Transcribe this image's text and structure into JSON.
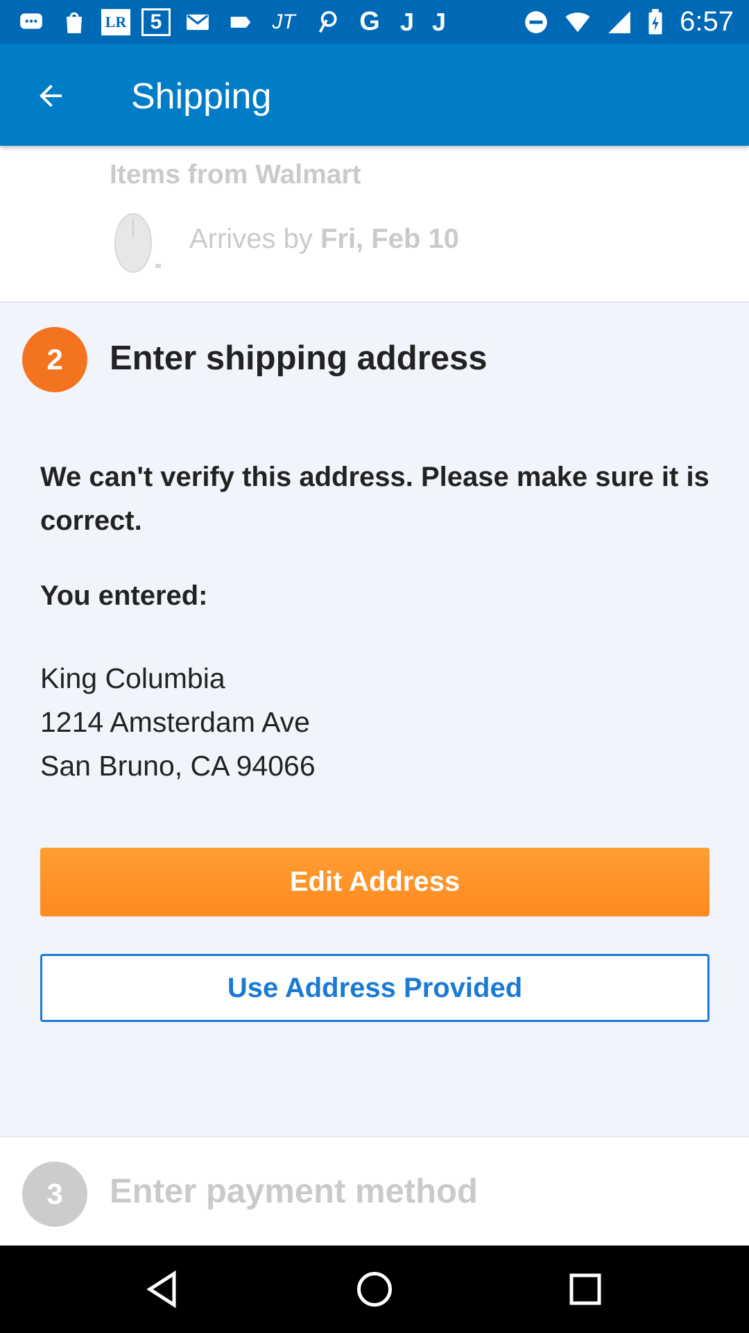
{
  "status_bar": {
    "time": "6:57",
    "left_icons": [
      "messaging-icon",
      "shopping-bag-icon",
      "lr-icon",
      "channel-5-icon",
      "gmail-icon",
      "tag-icon",
      "jt-icon",
      "pinterest-icon",
      "google-icon",
      "j-icon",
      "j-icon"
    ],
    "right_icons": [
      "do-not-disturb-icon",
      "wifi-icon",
      "signal-icon",
      "battery-charging-icon"
    ],
    "lr_label": "LR",
    "five_label": "5",
    "jt_label": "JT",
    "g_label": "G",
    "j_label": "J"
  },
  "app_bar": {
    "title": "Shipping",
    "background": "#007dc6"
  },
  "items": {
    "title": "Items from Walmart",
    "arrives_prefix": "Arrives by ",
    "arrives_date": "Fri, Feb 10"
  },
  "shipping_step": {
    "number": "2",
    "heading": "Enter shipping address",
    "warning": "We can't verify this address. Please make sure it is correct.",
    "entered_label": "You entered:",
    "address": {
      "line1": "King Columbia",
      "line2": "1214 Amsterdam Ave",
      "line3": "San Bruno, CA 94066"
    },
    "edit_button": "Edit Address",
    "use_button": "Use Address Provided",
    "accent_orange": "#f47321",
    "accent_blue": "#1a7ad4"
  },
  "payment_step": {
    "number": "3",
    "heading": "Enter payment method"
  },
  "nav_bar": {
    "icons": [
      "nav-back-icon",
      "nav-home-icon",
      "nav-recent-apps-icon"
    ]
  }
}
